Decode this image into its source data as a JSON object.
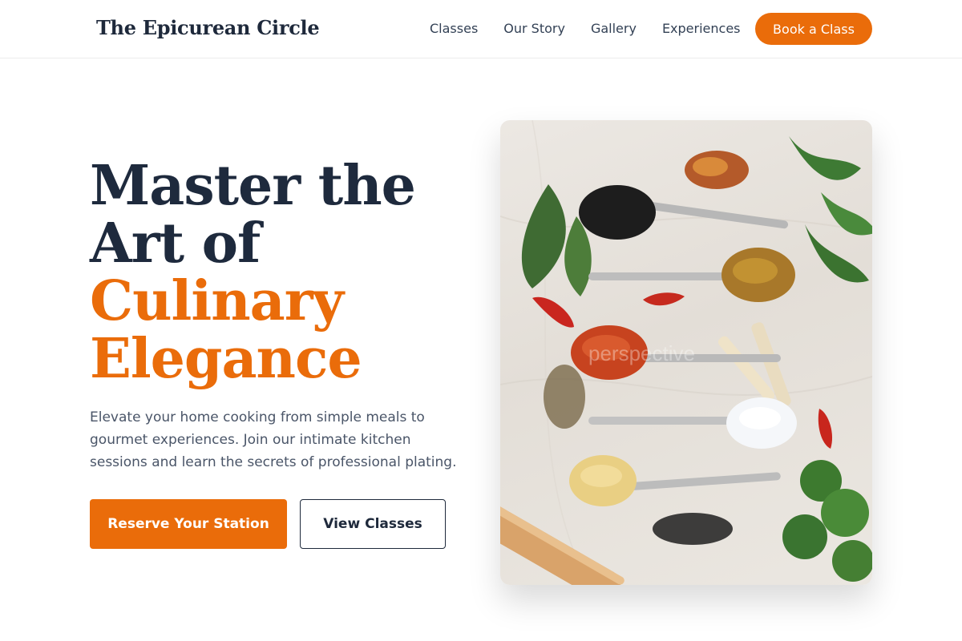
{
  "brand": {
    "name": "The Epicurean Circle"
  },
  "nav": {
    "links": [
      "Classes",
      "Our Story",
      "Gallery",
      "Experiences"
    ],
    "cta": "Book a Class"
  },
  "hero": {
    "title_line1": "Master the",
    "title_line2": "Art of",
    "title_accent_line1": "Culinary",
    "title_accent_line2": "Elegance",
    "description": "Elevate your home cooking from simple meals to gourmet experiences. Join our intimate kitchen sessions and learn the secrets of professional plating.",
    "primary_button": "Reserve Your Station",
    "secondary_button": "View Classes",
    "image_watermark": "perspective"
  },
  "colors": {
    "accent": "#ea6c0a",
    "heading": "#1e2a3d",
    "body_text": "#4a5568"
  }
}
